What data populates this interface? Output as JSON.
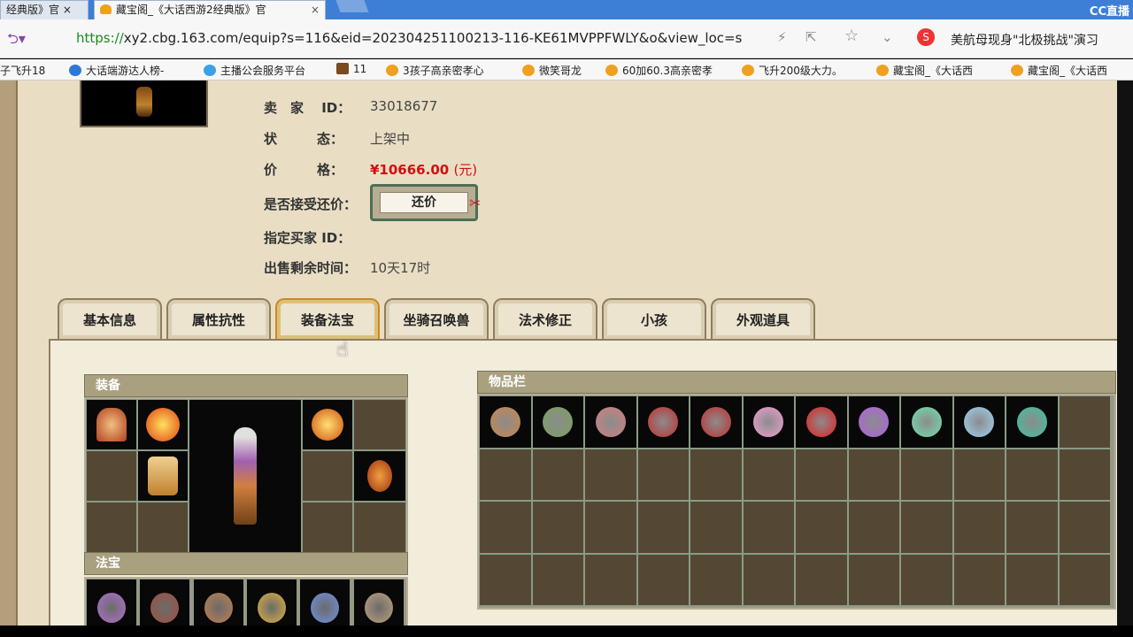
{
  "browser": {
    "tabs": [
      {
        "label": "经典版》官 ×"
      },
      {
        "label": "藏宝阁_《大话西游2经典版》官"
      }
    ],
    "cc_label": "CC直播",
    "url_scheme": "https://",
    "url_rest": "xy2.cbg.163.com/equip?s=116&eid=202304251100213-116-KE61MVPPFWLY&o&view_loc=s",
    "news": "美航母现身\"北极挑战\"演习",
    "bookmarks": [
      "子飞升18",
      "大话端游达人榜-",
      "主播公会服务平台",
      "11",
      "3孩子高亲密孝心",
      "微笑哥龙",
      "60加60.3高亲密孝",
      "飞升200级大力。",
      "藏宝阁_《大话西",
      "藏宝阁_《大话西"
    ]
  },
  "seller": {
    "id_label": "卖　家　 ID：",
    "id_value": "33018677",
    "status_label": "状　　　态：",
    "status_value": "上架中",
    "price_label": "价　　　格：",
    "price_value": "¥10666.00",
    "price_unit": "(元)",
    "counter_label": "是否接受还价：",
    "counter_button": "还价",
    "buyer_label": "指定买家 ID：",
    "time_label": "出售剩余时间：",
    "time_value": "10天17时"
  },
  "tabs": [
    "基本信息",
    "属性抗性",
    "装备法宝",
    "坐骑召唤兽",
    "法术修正",
    "小孩",
    "外观道具"
  ],
  "active_tab": "装备法宝",
  "sections": {
    "equipment": "装备",
    "treasure": "法宝",
    "inventory": "物品栏"
  },
  "colors": {
    "page_bg": "#e9dec4",
    "price": "#d01010",
    "cell_bg": "#544834",
    "active_tab_border": "#c88a22"
  },
  "inventory_items": [
    {
      "icon": "rope-icon",
      "color": "#c9874a"
    },
    {
      "icon": "dragon-icon",
      "color": "#7aa060"
    },
    {
      "icon": "mask-icon",
      "color": "#d08080"
    },
    {
      "icon": "spear-icon",
      "color": "#c03030"
    },
    {
      "icon": "spear-icon",
      "color": "#c03030"
    },
    {
      "icon": "heart-gem-icon",
      "color": "#f0a0d0"
    },
    {
      "icon": "red-gem-icon",
      "color": "#e02020"
    },
    {
      "icon": "purple-crystal-icon",
      "color": "#b060e0"
    },
    {
      "icon": "green-crystal-icon",
      "color": "#70e0b0"
    },
    {
      "icon": "ice-cube-icon",
      "color": "#a0d0f0"
    },
    {
      "icon": "jade-icon",
      "color": "#40c0a0"
    }
  ],
  "treasure_items": [
    {
      "icon": "lantern-icon",
      "color": "#b070d0"
    },
    {
      "icon": "scroll-icon",
      "color": "#a05040"
    },
    {
      "icon": "pipa-icon",
      "color": "#c08050"
    },
    {
      "icon": "pagoda-icon",
      "color": "#e0b040"
    },
    {
      "icon": "glove-icon",
      "color": "#7090e0"
    },
    {
      "icon": "bell-icon",
      "color": "#c0a080"
    }
  ]
}
